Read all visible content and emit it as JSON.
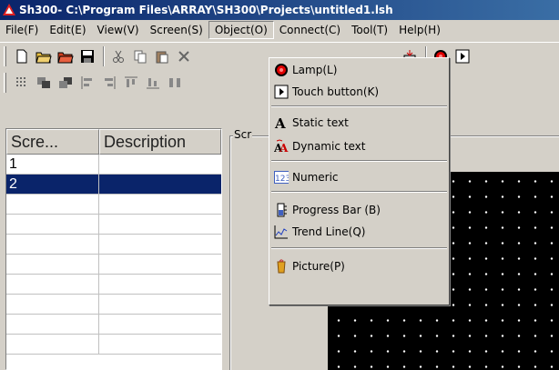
{
  "window": {
    "title": "Sh300- C:\\Program Files\\ARRAY\\SH300\\Projects\\untitled1.lsh"
  },
  "menubar": [
    "File(F)",
    "Edit(E)",
    "View(V)",
    "Screen(S)",
    "Object(O)",
    "Connect(C)",
    "Tool(T)",
    "Help(H)"
  ],
  "object_menu": {
    "lamp": "Lamp(L)",
    "touch_button": "Touch button(K)",
    "static_text": "Static  text",
    "dynamic_text": "Dynamic text",
    "numeric": "Numeric",
    "progress_bar": "Progress Bar  (B)",
    "trend_line": "Trend Line(Q)",
    "picture": "Picture(P)"
  },
  "screen_list": {
    "headers": [
      "Scre...",
      "Description"
    ],
    "rows": [
      {
        "screen": "1",
        "description": ""
      },
      {
        "screen": "2",
        "description": ""
      }
    ],
    "selected_index": 1
  },
  "screen_group_label": "Scr",
  "colors": {
    "title_start": "#0a246a",
    "title_end": "#3a6ea5",
    "selection": "#0a246a",
    "canvas": "#000000",
    "face": "#d4d0c8"
  },
  "icons": [
    "new-icon",
    "open-icon",
    "open-folder-icon",
    "save-icon",
    "cut-icon",
    "copy-icon",
    "paste-icon",
    "delete-icon",
    "lamp-icon",
    "play-icon",
    "help-icon"
  ]
}
